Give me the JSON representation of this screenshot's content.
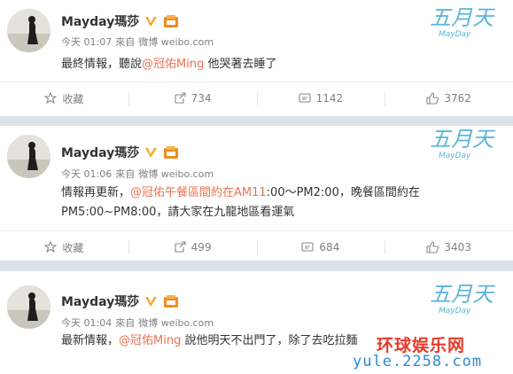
{
  "posts": [
    {
      "author": "Mayday瑪莎",
      "time": "今天 01:07",
      "source_prefix": "來自",
      "source": "微博 weibo.com",
      "text_parts": [
        {
          "t": "最終情報，聽說",
          "mention": false
        },
        {
          "t": "@冠佑Ming",
          "mention": true
        },
        {
          "t": " 他哭著去睡了",
          "mention": false
        }
      ],
      "actions": {
        "favorite": "收藏",
        "repost": "734",
        "comment": "1142",
        "like": "3762"
      }
    },
    {
      "author": "Mayday瑪莎",
      "time": "今天 01:06",
      "source_prefix": "來自",
      "source": "微博 weibo.com",
      "text_parts": [
        {
          "t": "情報再更新，",
          "mention": false
        },
        {
          "t": "@冠佑午餐區間約在AM11",
          "mention": true
        },
        {
          "t": ":00～PM2:00，晚餐區間約在PM5:00~PM8:00，請大家在九龍地區看運氣",
          "mention": false
        }
      ],
      "actions": {
        "favorite": "收藏",
        "repost": "499",
        "comment": "684",
        "like": "3403"
      }
    },
    {
      "author": "Mayday瑪莎",
      "time": "今天 01:04",
      "source_prefix": "來自",
      "source": "微博 weibo.com",
      "text_parts": [
        {
          "t": "最新情報，",
          "mention": false
        },
        {
          "t": "@冠佑Ming",
          "mention": true
        },
        {
          "t": " 說他明天不出門了，除了去吃拉麵",
          "mention": false
        }
      ]
    }
  ],
  "brand_logo_text": "五月天",
  "watermark": {
    "line1": "环球娱乐网",
    "line2": "yule.2258.com"
  },
  "colors": {
    "mention": "#eb7350",
    "verified": "#f5a623",
    "watermark_red": "#e83a2a",
    "watermark_blue": "#2f8bd0"
  },
  "icons": [
    "verified-icon",
    "member-badge-icon",
    "favorite-icon",
    "repost-icon",
    "comment-icon",
    "like-icon"
  ]
}
